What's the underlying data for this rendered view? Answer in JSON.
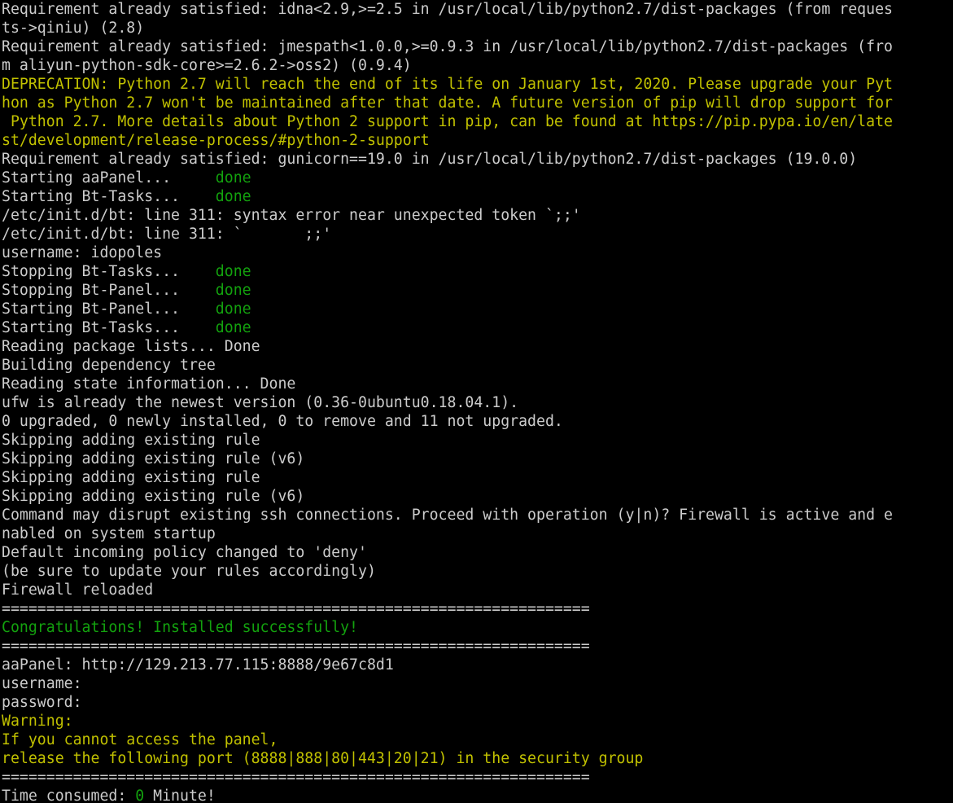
{
  "colors": {
    "background": "#000000",
    "default": "#cccccc",
    "yellow": "#c1c100",
    "green": "#13a10e"
  },
  "terminal": {
    "lines": [
      [
        {
          "t": "Requirement already satisfied: idna<2.9,>=2.5 in /usr/local/lib/python2.7/dist-packages (from reques",
          "c": "default"
        }
      ],
      [
        {
          "t": "ts->qiniu) (2.8)",
          "c": "default"
        }
      ],
      [
        {
          "t": "Requirement already satisfied: jmespath<1.0.0,>=0.9.3 in /usr/local/lib/python2.7/dist-packages (fro",
          "c": "default"
        }
      ],
      [
        {
          "t": "m aliyun-python-sdk-core>=2.6.2->oss2) (0.9.4)",
          "c": "default"
        }
      ],
      [
        {
          "t": "DEPRECATION: Python 2.7 will reach the end of its life on January 1st, 2020. Please upgrade your Pyt",
          "c": "yellow"
        }
      ],
      [
        {
          "t": "hon as Python 2.7 won't be maintained after that date. A future version of pip will drop support for",
          "c": "yellow"
        }
      ],
      [
        {
          "t": " Python 2.7. More details about Python 2 support in pip, can be found at https://pip.pypa.io/en/late",
          "c": "yellow"
        }
      ],
      [
        {
          "t": "st/development/release-process/#python-2-support",
          "c": "yellow"
        }
      ],
      [
        {
          "t": "Requirement already satisfied: gunicorn==19.0 in /usr/local/lib/python2.7/dist-packages (19.0.0)",
          "c": "default"
        }
      ],
      [
        {
          "t": "Starting aaPanel...     ",
          "c": "default"
        },
        {
          "t": "done",
          "c": "green"
        }
      ],
      [
        {
          "t": "Starting Bt-Tasks...    ",
          "c": "default"
        },
        {
          "t": "done",
          "c": "green"
        }
      ],
      [
        {
          "t": "/etc/init.d/bt: line 311: syntax error near unexpected token `;;'",
          "c": "default"
        }
      ],
      [
        {
          "t": "/etc/init.d/bt: line 311: `       ;;'",
          "c": "default"
        }
      ],
      [
        {
          "t": "username: idopoles",
          "c": "default"
        }
      ],
      [
        {
          "t": "Stopping Bt-Tasks...    ",
          "c": "default"
        },
        {
          "t": "done",
          "c": "green"
        }
      ],
      [
        {
          "t": "Stopping Bt-Panel...    ",
          "c": "default"
        },
        {
          "t": "done",
          "c": "green"
        }
      ],
      [
        {
          "t": "Starting Bt-Panel...    ",
          "c": "default"
        },
        {
          "t": "done",
          "c": "green"
        }
      ],
      [
        {
          "t": "Starting Bt-Tasks...    ",
          "c": "default"
        },
        {
          "t": "done",
          "c": "green"
        }
      ],
      [
        {
          "t": "Reading package lists... Done",
          "c": "default"
        }
      ],
      [
        {
          "t": "Building dependency tree",
          "c": "default"
        }
      ],
      [
        {
          "t": "Reading state information... Done",
          "c": "default"
        }
      ],
      [
        {
          "t": "ufw is already the newest version (0.36-0ubuntu0.18.04.1).",
          "c": "default"
        }
      ],
      [
        {
          "t": "0 upgraded, 0 newly installed, 0 to remove and 11 not upgraded.",
          "c": "default"
        }
      ],
      [
        {
          "t": "Skipping adding existing rule",
          "c": "default"
        }
      ],
      [
        {
          "t": "Skipping adding existing rule (v6)",
          "c": "default"
        }
      ],
      [
        {
          "t": "Skipping adding existing rule",
          "c": "default"
        }
      ],
      [
        {
          "t": "Skipping adding existing rule (v6)",
          "c": "default"
        }
      ],
      [
        {
          "t": "Command may disrupt existing ssh connections. Proceed with operation (y|n)? Firewall is active and e",
          "c": "default"
        }
      ],
      [
        {
          "t": "nabled on system startup",
          "c": "default"
        }
      ],
      [
        {
          "t": "Default incoming policy changed to 'deny'",
          "c": "default"
        }
      ],
      [
        {
          "t": "(be sure to update your rules accordingly)",
          "c": "default"
        }
      ],
      [
        {
          "t": "Firewall reloaded",
          "c": "default"
        }
      ],
      [
        {
          "t": "==================================================================",
          "c": "default"
        }
      ],
      [
        {
          "t": "Congratulations! Installed successfully!",
          "c": "green"
        }
      ],
      [
        {
          "t": "==================================================================",
          "c": "default"
        }
      ],
      [
        {
          "t": "aaPanel: http://129.213.77.115:8888/9e67c8d1",
          "c": "default"
        }
      ],
      [
        {
          "t": "username:",
          "c": "default"
        }
      ],
      [
        {
          "t": "password:",
          "c": "default"
        }
      ],
      [
        {
          "t": "Warning:",
          "c": "yellow"
        }
      ],
      [
        {
          "t": "If you cannot access the panel,",
          "c": "yellow"
        }
      ],
      [
        {
          "t": "release the following port (8888|888|80|443|20|21) in the security group",
          "c": "yellow"
        }
      ],
      [
        {
          "t": "==================================================================",
          "c": "default"
        }
      ],
      [
        {
          "t": "Time consumed: ",
          "c": "default"
        },
        {
          "t": "0",
          "c": "green"
        },
        {
          "t": " Minute!",
          "c": "default"
        }
      ]
    ]
  }
}
